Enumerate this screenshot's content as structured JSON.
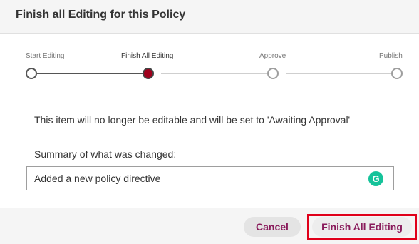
{
  "dialog": {
    "title": "Finish all Editing for this Policy"
  },
  "stepper": {
    "steps": [
      {
        "label": "Start Editing",
        "state": "done"
      },
      {
        "label": "Finish All Editing",
        "state": "current"
      },
      {
        "label": "Approve",
        "state": "pending"
      },
      {
        "label": "Publish",
        "state": "pending"
      }
    ],
    "colors": {
      "current": "#a0001c",
      "done": "#555555",
      "pending": "#9e9e9e"
    }
  },
  "body": {
    "message": "This item will no longer be editable and will be set to 'Awaiting Approval'",
    "summary_label": "Summary of what was changed:",
    "summary_value": "Added a new policy directive",
    "grammarly_glyph": "G",
    "grammarly_icon": "grammarly-icon"
  },
  "footer": {
    "cancel_label": "Cancel",
    "finish_label": "Finish All Editing",
    "accent_color": "#8a1c5c",
    "highlight_color": "#e0001a"
  }
}
